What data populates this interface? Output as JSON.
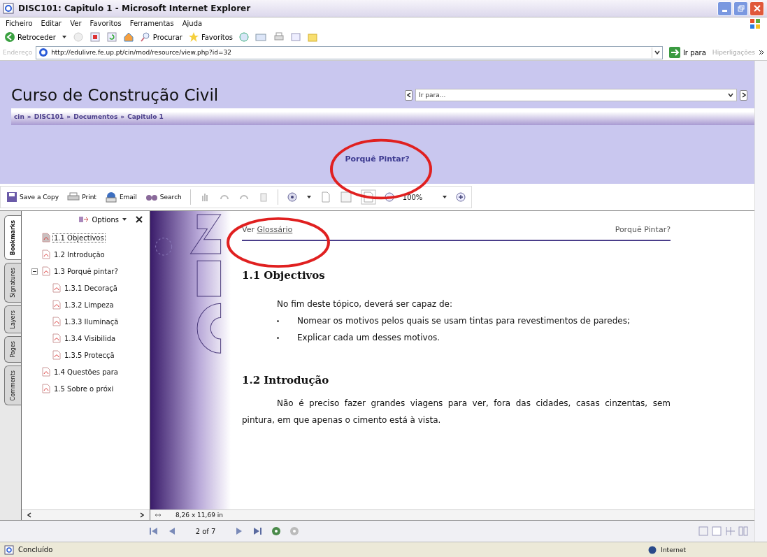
{
  "window": {
    "title": "DISC101: Capitulo 1 - Microsoft Internet Explorer"
  },
  "menu": [
    "Ficheiro",
    "Editar",
    "Ver",
    "Favoritos",
    "Ferramentas",
    "Ajuda"
  ],
  "toolbar": [
    {
      "kind": "back",
      "label": "Retroceder"
    },
    {
      "kind": "search",
      "label": "Procurar"
    },
    {
      "kind": "favorites",
      "label": "Favoritos"
    }
  ],
  "address": {
    "label": "Endereço",
    "value": "http://edulivre.fe.up.pt/cin/mod/resource/view.php?id=32",
    "go": "Ir para",
    "links": "Hiperligações"
  },
  "site": {
    "title": "Curso de Construção Civil",
    "jump_placeholder": "Ir para...",
    "separator": "»",
    "breadcrumb": [
      "cin",
      "DISC101",
      "Documentos",
      "Capitulo 1"
    ],
    "banner_link": "Porquê Pintar?"
  },
  "pdf_toolbar": {
    "buttons": [
      {
        "kind": "save",
        "label": "Save a Copy"
      },
      {
        "kind": "print",
        "label": "Print"
      },
      {
        "kind": "email",
        "label": "Email"
      },
      {
        "kind": "search",
        "label": "Search"
      }
    ],
    "zoom": "100%"
  },
  "side_tabs": [
    {
      "label": "Bookmarks",
      "selected": true
    },
    {
      "label": "Signatures",
      "selected": false
    },
    {
      "label": "Layers",
      "selected": false
    },
    {
      "label": "Pages",
      "selected": false
    },
    {
      "label": "Comments",
      "selected": false
    }
  ],
  "bookmarks": {
    "options": "Options",
    "items": [
      {
        "label": "1.1 Objectivos",
        "selected": true
      },
      {
        "label": "1.2 Introdução",
        "selected": false
      },
      {
        "label": "1.3 Porquê pintar?",
        "selected": false,
        "expanded": true,
        "children": [
          {
            "label": "1.3.1 Decoraçã",
            "selected": false
          },
          {
            "label": "1.3.2 Limpeza",
            "selected": false
          },
          {
            "label": "1.3.3 Iluminaçã",
            "selected": false
          },
          {
            "label": "1.3.4 Visibilida",
            "selected": false
          },
          {
            "label": "1.3.5 Protecçã",
            "selected": false
          }
        ]
      },
      {
        "label": "1.4 Questões para",
        "selected": false
      },
      {
        "label": "1.5 Sobre o próxi",
        "selected": false
      }
    ]
  },
  "document": {
    "see": "Ver",
    "glossary": "Glossário",
    "top_link": "Porquê Pintar?",
    "sections": [
      {
        "heading": "1.1 Objectivos",
        "paragraph": "No fim deste tópico, deverá ser capaz de:",
        "bullets": [
          "Nomear os motivos pelos quais se usam tintas para revestimentos de paredes;",
          "Explicar cada um desses motivos."
        ]
      },
      {
        "heading": "1.2 Introdução",
        "paragraph": "Não é preciso fazer grandes viagens para ver, fora das cidades, casas cinzentas, sem pintura, em que apenas o cimento está à vista."
      }
    ]
  },
  "page_size": "8,26 x 11,69 in",
  "page_indicator": "2 of 7",
  "status": {
    "text": "Concluído",
    "zone": "Internet"
  }
}
